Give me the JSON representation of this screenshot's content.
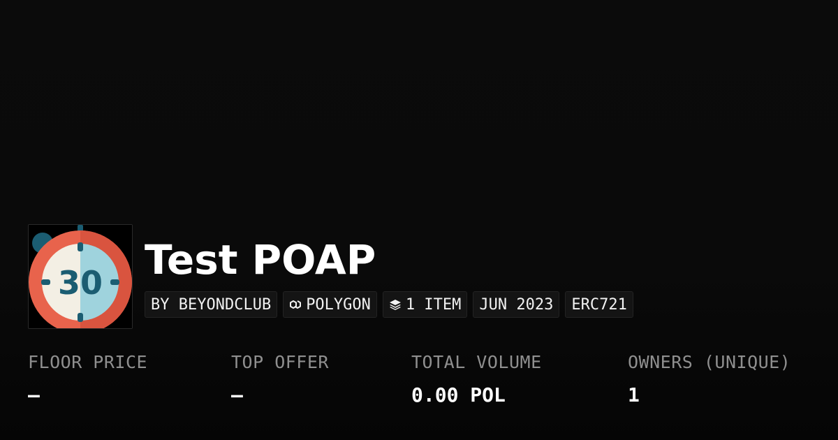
{
  "collection": {
    "title": "Test POAP",
    "avatar": {
      "icon": "timer-30-icon",
      "text": "30",
      "colors": {
        "ring": "#e8634c",
        "face_left": "#f3efe4",
        "face_right": "#9fd3dd",
        "digits": "#1b5d72",
        "knob": "#1b5d72"
      }
    }
  },
  "tags": [
    {
      "label": "BY BEYONDCLUB",
      "icon": ""
    },
    {
      "label": "POLYGON",
      "icon": "polygon-chain-icon"
    },
    {
      "label": "1 ITEM",
      "icon": "layers-icon"
    },
    {
      "label": "JUN 2023",
      "icon": ""
    },
    {
      "label": "ERC721",
      "icon": ""
    }
  ],
  "stats": [
    {
      "label": "FLOOR PRICE",
      "value": "–"
    },
    {
      "label": "TOP OFFER",
      "value": "–"
    },
    {
      "label": "TOTAL VOLUME",
      "value": "0.00 POL"
    },
    {
      "label": "OWNERS (UNIQUE)",
      "value": "1"
    }
  ],
  "colors": {
    "background": "#0a0a0a",
    "text_primary": "#ffffff",
    "text_muted": "#8f8f8f",
    "tag_background": "#141414",
    "tag_border": "#232323"
  }
}
